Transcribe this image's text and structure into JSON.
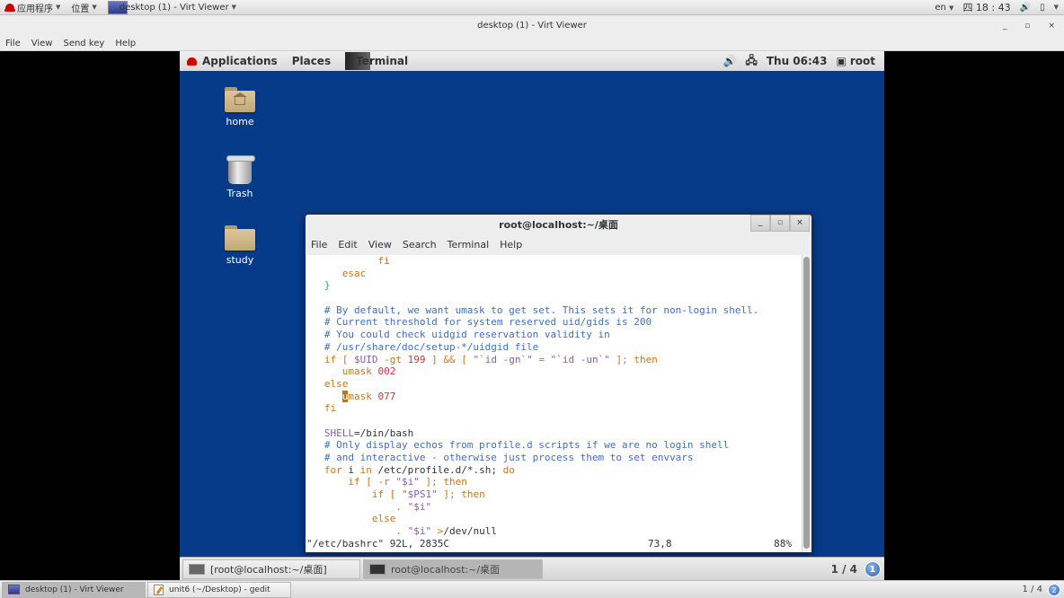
{
  "host": {
    "top_panel": {
      "applications_label": "应用程序",
      "places_label": "位置",
      "active_app_label": "desktop (1) - Virt Viewer",
      "input_method": "en",
      "clock": "四 18 : 43",
      "icons": [
        "redhat-logo-icon",
        "volume-icon",
        "battery-icon"
      ]
    },
    "bottom_panel": {
      "tasks": [
        {
          "label": "desktop (1) - Virt Viewer",
          "icon": "monitor-icon",
          "active": true
        },
        {
          "label": "unit6 (~/Desktop) - gedit",
          "icon": "gedit-icon",
          "active": false
        }
      ],
      "workspace_label": "1 / 4",
      "notification_count": "2"
    }
  },
  "virt_viewer": {
    "title": "desktop (1) - Virt Viewer",
    "window_buttons": {
      "minimize": "_",
      "maximize": "▫",
      "close": "×"
    },
    "menu": [
      "File",
      "View",
      "Send key",
      "Help"
    ]
  },
  "guest": {
    "top_panel": {
      "applications_label": "Applications",
      "places_label": "Places",
      "active_app_label": "Terminal",
      "clock": "Thu 06:43",
      "user": "root"
    },
    "desktop_icons": [
      {
        "label": "home",
        "icon": "home-folder-icon"
      },
      {
        "label": "Trash",
        "icon": "trash-icon"
      },
      {
        "label": "study",
        "icon": "folder-icon"
      }
    ],
    "terminal": {
      "title": "root@localhost:~/桌面",
      "menu": [
        "File",
        "Edit",
        "View",
        "Search",
        "Terminal",
        "Help"
      ],
      "lines": [
        [
          {
            "t": "            ",
            "c": ""
          },
          {
            "t": "fi",
            "c": "c-kw"
          }
        ],
        [
          {
            "t": "      ",
            "c": ""
          },
          {
            "t": "esac",
            "c": "c-kw"
          }
        ],
        [
          {
            "t": "   ",
            "c": ""
          },
          {
            "t": "}",
            "c": "c-br"
          }
        ],
        [
          {
            "t": "",
            "c": ""
          }
        ],
        [
          {
            "t": "   # By default, we want umask to get set. This sets it for non-login shell.",
            "c": "c-com"
          }
        ],
        [
          {
            "t": "   # Current threshold for system reserved uid/gids is 200",
            "c": "c-com"
          }
        ],
        [
          {
            "t": "   # You could check uidgid reservation validity in",
            "c": "c-com"
          }
        ],
        [
          {
            "t": "   # /usr/share/doc/setup-*/uidgid file",
            "c": "c-com"
          }
        ],
        [
          {
            "t": "   ",
            "c": ""
          },
          {
            "t": "if [ ",
            "c": "c-kw"
          },
          {
            "t": "$UID",
            "c": "c-var"
          },
          {
            "t": " -gt ",
            "c": "c-kw"
          },
          {
            "t": "199",
            "c": "c-num"
          },
          {
            "t": " ] && [ ",
            "c": "c-kw"
          },
          {
            "t": "\"`id -gn`\"",
            "c": "c-str"
          },
          {
            "t": " = ",
            "c": "c-kw"
          },
          {
            "t": "\"`id -un`\"",
            "c": "c-str"
          },
          {
            "t": " ]; then",
            "c": "c-kw"
          }
        ],
        [
          {
            "t": "      ",
            "c": ""
          },
          {
            "t": "umask ",
            "c": "c-kw"
          },
          {
            "t": "002",
            "c": "c-num"
          }
        ],
        [
          {
            "t": "   ",
            "c": ""
          },
          {
            "t": "else",
            "c": "c-kw"
          }
        ],
        [
          {
            "t": "      ",
            "c": ""
          },
          {
            "t": "u",
            "c": "cursor"
          },
          {
            "t": "mask ",
            "c": "c-kw"
          },
          {
            "t": "077",
            "c": "c-num"
          }
        ],
        [
          {
            "t": "   ",
            "c": ""
          },
          {
            "t": "fi",
            "c": "c-kw"
          }
        ],
        [
          {
            "t": "",
            "c": ""
          }
        ],
        [
          {
            "t": "   ",
            "c": ""
          },
          {
            "t": "SHELL",
            "c": "c-var"
          },
          {
            "t": "=/bin/bash",
            "c": ""
          }
        ],
        [
          {
            "t": "   # Only display echos from profile.d scripts if we are no login shell",
            "c": "c-com"
          }
        ],
        [
          {
            "t": "   # and interactive - otherwise just process them to set envvars",
            "c": "c-com"
          }
        ],
        [
          {
            "t": "   ",
            "c": ""
          },
          {
            "t": "for",
            "c": "c-kw"
          },
          {
            "t": " i ",
            "c": ""
          },
          {
            "t": "in",
            "c": "c-kw"
          },
          {
            "t": " /etc/profile.d/*.sh; ",
            "c": ""
          },
          {
            "t": "do",
            "c": "c-kw"
          }
        ],
        [
          {
            "t": "       ",
            "c": ""
          },
          {
            "t": "if [ -r ",
            "c": "c-kw"
          },
          {
            "t": "\"$i\"",
            "c": "c-str"
          },
          {
            "t": " ]; then",
            "c": "c-kw"
          }
        ],
        [
          {
            "t": "           ",
            "c": ""
          },
          {
            "t": "if [ ",
            "c": "c-kw"
          },
          {
            "t": "\"$PS1\"",
            "c": "c-str"
          },
          {
            "t": " ]; then",
            "c": "c-kw"
          }
        ],
        [
          {
            "t": "               ",
            "c": ""
          },
          {
            "t": ". ",
            "c": "c-kw"
          },
          {
            "t": "\"$i\"",
            "c": "c-str"
          }
        ],
        [
          {
            "t": "           ",
            "c": ""
          },
          {
            "t": "else",
            "c": "c-kw"
          }
        ],
        [
          {
            "t": "               ",
            "c": ""
          },
          {
            "t": ". ",
            "c": "c-kw"
          },
          {
            "t": "\"$i\"",
            "c": "c-str"
          },
          {
            "t": " >",
            "c": "c-op"
          },
          {
            "t": "/dev/null",
            "c": ""
          }
        ]
      ],
      "status": {
        "file_info": "\"/etc/bashrc\" 92L, 2835C",
        "position": "73,8",
        "percent": "88%"
      }
    },
    "bottom_panel": {
      "tasks": [
        {
          "label": "[root@localhost:~/桌面]",
          "active": false
        },
        {
          "label": "root@localhost:~/桌面",
          "active": true
        }
      ],
      "workspace_label": "1 / 4",
      "notification_count": "1"
    }
  }
}
